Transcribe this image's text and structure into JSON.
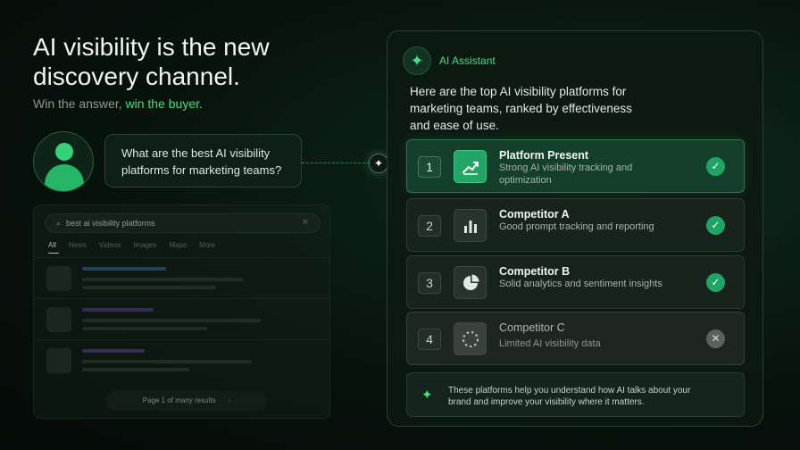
{
  "hero": {
    "headline": "AI visibility is the new discovery channel.",
    "subline_prefix": "Win the answer, ",
    "subline_accent": "win the buyer."
  },
  "chat": {
    "question": "What are the best AI visibility platforms for marketing teams?"
  },
  "search": {
    "query": "best ai visibility platforms",
    "tabs": [
      "All",
      "News",
      "Videos",
      "Images",
      "Maps",
      "More"
    ],
    "active_tab": "All",
    "pagination": "Page 1 of many results",
    "icons": {
      "search": "search-icon",
      "clear": "close-icon",
      "next": "chevron-right-icon"
    }
  },
  "assistant": {
    "label": "AI Assistant",
    "intro": "Here are the top AI visibility platforms for marketing teams, ranked by effectiveness and ease of use.",
    "results": [
      {
        "rank": "1",
        "name": "Platform Present",
        "desc": "Strong AI visibility tracking and optimization",
        "icon": "trend-chart-icon",
        "status": "check"
      },
      {
        "rank": "2",
        "name": "Competitor A",
        "desc": "Good prompt tracking and reporting",
        "icon": "bar-chart-icon",
        "status": "check"
      },
      {
        "rank": "3",
        "name": "Competitor B",
        "desc": "Solid analytics and sentiment insights",
        "icon": "pie-chart-icon",
        "status": "check"
      },
      {
        "rank": "4",
        "name": "Competitor C",
        "desc": "Limited AI visibility data",
        "icon": "dotted-circle-icon",
        "status": "cross"
      }
    ],
    "footer": "These platforms help you understand how AI talks about your brand and improve your visibility where it matters."
  },
  "colors": {
    "accent": "#4ade80",
    "check": "#1fa463",
    "cross": "#5a625d",
    "background": "#08130d"
  }
}
